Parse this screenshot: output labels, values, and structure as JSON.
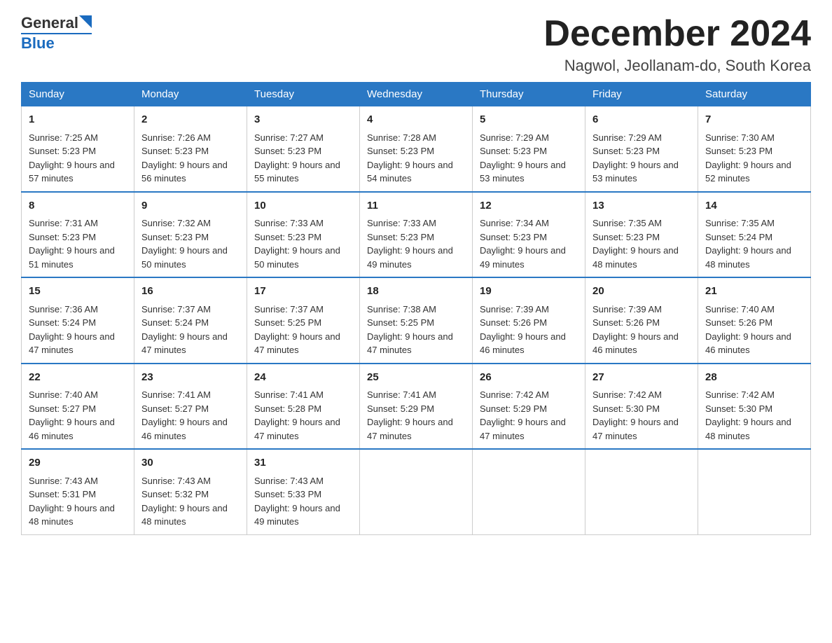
{
  "header": {
    "logo": {
      "general": "General",
      "blue": "Blue"
    },
    "title": "December 2024",
    "location": "Nagwol, Jeollanam-do, South Korea"
  },
  "days": [
    "Sunday",
    "Monday",
    "Tuesday",
    "Wednesday",
    "Thursday",
    "Friday",
    "Saturday"
  ],
  "weeks": [
    [
      {
        "day": "1",
        "sunrise": "7:25 AM",
        "sunset": "5:23 PM",
        "daylight": "9 hours and 57 minutes."
      },
      {
        "day": "2",
        "sunrise": "7:26 AM",
        "sunset": "5:23 PM",
        "daylight": "9 hours and 56 minutes."
      },
      {
        "day": "3",
        "sunrise": "7:27 AM",
        "sunset": "5:23 PM",
        "daylight": "9 hours and 55 minutes."
      },
      {
        "day": "4",
        "sunrise": "7:28 AM",
        "sunset": "5:23 PM",
        "daylight": "9 hours and 54 minutes."
      },
      {
        "day": "5",
        "sunrise": "7:29 AM",
        "sunset": "5:23 PM",
        "daylight": "9 hours and 53 minutes."
      },
      {
        "day": "6",
        "sunrise": "7:29 AM",
        "sunset": "5:23 PM",
        "daylight": "9 hours and 53 minutes."
      },
      {
        "day": "7",
        "sunrise": "7:30 AM",
        "sunset": "5:23 PM",
        "daylight": "9 hours and 52 minutes."
      }
    ],
    [
      {
        "day": "8",
        "sunrise": "7:31 AM",
        "sunset": "5:23 PM",
        "daylight": "9 hours and 51 minutes."
      },
      {
        "day": "9",
        "sunrise": "7:32 AM",
        "sunset": "5:23 PM",
        "daylight": "9 hours and 50 minutes."
      },
      {
        "day": "10",
        "sunrise": "7:33 AM",
        "sunset": "5:23 PM",
        "daylight": "9 hours and 50 minutes."
      },
      {
        "day": "11",
        "sunrise": "7:33 AM",
        "sunset": "5:23 PM",
        "daylight": "9 hours and 49 minutes."
      },
      {
        "day": "12",
        "sunrise": "7:34 AM",
        "sunset": "5:23 PM",
        "daylight": "9 hours and 49 minutes."
      },
      {
        "day": "13",
        "sunrise": "7:35 AM",
        "sunset": "5:23 PM",
        "daylight": "9 hours and 48 minutes."
      },
      {
        "day": "14",
        "sunrise": "7:35 AM",
        "sunset": "5:24 PM",
        "daylight": "9 hours and 48 minutes."
      }
    ],
    [
      {
        "day": "15",
        "sunrise": "7:36 AM",
        "sunset": "5:24 PM",
        "daylight": "9 hours and 47 minutes."
      },
      {
        "day": "16",
        "sunrise": "7:37 AM",
        "sunset": "5:24 PM",
        "daylight": "9 hours and 47 minutes."
      },
      {
        "day": "17",
        "sunrise": "7:37 AM",
        "sunset": "5:25 PM",
        "daylight": "9 hours and 47 minutes."
      },
      {
        "day": "18",
        "sunrise": "7:38 AM",
        "sunset": "5:25 PM",
        "daylight": "9 hours and 47 minutes."
      },
      {
        "day": "19",
        "sunrise": "7:39 AM",
        "sunset": "5:26 PM",
        "daylight": "9 hours and 46 minutes."
      },
      {
        "day": "20",
        "sunrise": "7:39 AM",
        "sunset": "5:26 PM",
        "daylight": "9 hours and 46 minutes."
      },
      {
        "day": "21",
        "sunrise": "7:40 AM",
        "sunset": "5:26 PM",
        "daylight": "9 hours and 46 minutes."
      }
    ],
    [
      {
        "day": "22",
        "sunrise": "7:40 AM",
        "sunset": "5:27 PM",
        "daylight": "9 hours and 46 minutes."
      },
      {
        "day": "23",
        "sunrise": "7:41 AM",
        "sunset": "5:27 PM",
        "daylight": "9 hours and 46 minutes."
      },
      {
        "day": "24",
        "sunrise": "7:41 AM",
        "sunset": "5:28 PM",
        "daylight": "9 hours and 47 minutes."
      },
      {
        "day": "25",
        "sunrise": "7:41 AM",
        "sunset": "5:29 PM",
        "daylight": "9 hours and 47 minutes."
      },
      {
        "day": "26",
        "sunrise": "7:42 AM",
        "sunset": "5:29 PM",
        "daylight": "9 hours and 47 minutes."
      },
      {
        "day": "27",
        "sunrise": "7:42 AM",
        "sunset": "5:30 PM",
        "daylight": "9 hours and 47 minutes."
      },
      {
        "day": "28",
        "sunrise": "7:42 AM",
        "sunset": "5:30 PM",
        "daylight": "9 hours and 48 minutes."
      }
    ],
    [
      {
        "day": "29",
        "sunrise": "7:43 AM",
        "sunset": "5:31 PM",
        "daylight": "9 hours and 48 minutes."
      },
      {
        "day": "30",
        "sunrise": "7:43 AM",
        "sunset": "5:32 PM",
        "daylight": "9 hours and 48 minutes."
      },
      {
        "day": "31",
        "sunrise": "7:43 AM",
        "sunset": "5:33 PM",
        "daylight": "9 hours and 49 minutes."
      },
      null,
      null,
      null,
      null
    ]
  ]
}
